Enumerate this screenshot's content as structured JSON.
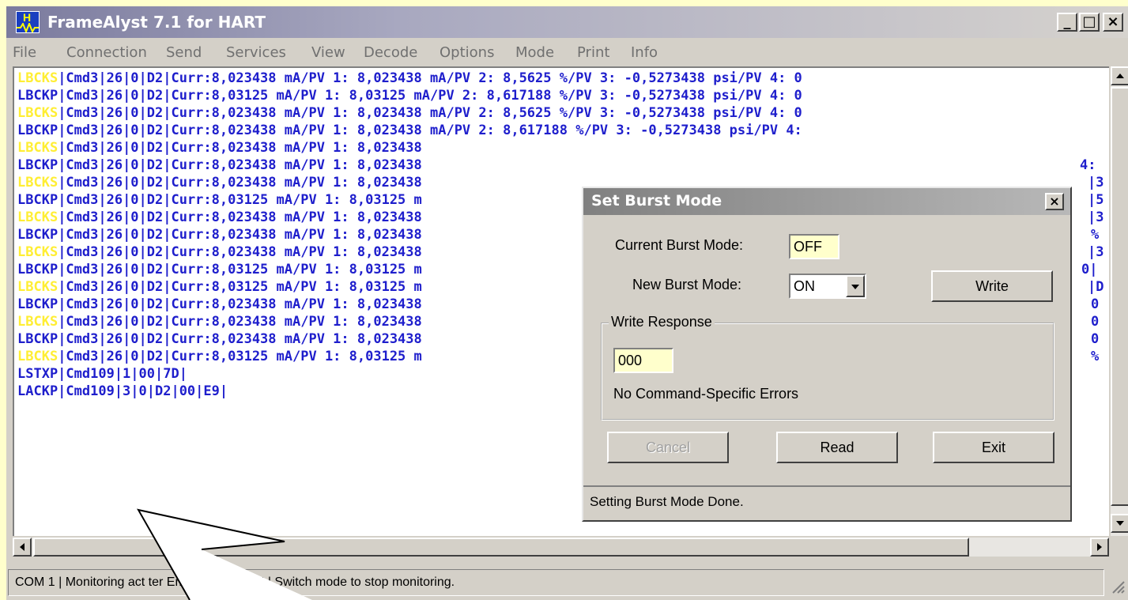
{
  "window": {
    "title": "FrameAlyst 7.1 for HART",
    "icon_letter": "H"
  },
  "menu": [
    "File",
    "Connection",
    "Send",
    "Services",
    "View",
    "Decode",
    "Options",
    "Mode",
    "Print",
    "Info"
  ],
  "log": {
    "lines": [
      {
        "src": "LBCKS",
        "text": "|Cmd3|26|0|D2|Curr:8,023438 mA/PV 1: 8,023438 mA/PV 2: 8,5625 %/PV 3: -0,5273438 psi/PV 4: 0"
      },
      {
        "src": "LBCKP",
        "text": "|Cmd3|26|0|D2|Curr:8,03125 mA/PV 1: 8,03125 mA/PV 2: 8,617188 %/PV 3: -0,5273438 psi/PV 4: 0"
      },
      {
        "src": "LBCKS",
        "text": "|Cmd3|26|0|D2|Curr:8,023438 mA/PV 1: 8,023438 mA/PV 2: 8,5625 %/PV 3: -0,5273438 psi/PV 4: 0"
      },
      {
        "src": "LBCKP",
        "text": "|Cmd3|26|0|D2|Curr:8,023438 mA/PV 1: 8,023438 mA/PV 2: 8,617188 %/PV 3: -0,5273438 psi/PV 4:"
      },
      {
        "src": "LBCKS",
        "text": "|Cmd3|26|0|D2|Curr:8,023438 mA/PV 1: 8,023438"
      },
      {
        "src": "LBCKP",
        "text": "|Cmd3|26|0|D2|Curr:8,023438 mA/PV 1: 8,023438"
      },
      {
        "src": "LBCKS",
        "text": "|Cmd3|26|0|D2|Curr:8,023438 mA/PV 1: 8,023438"
      },
      {
        "src": "LBCKP",
        "text": "|Cmd3|26|0|D2|Curr:8,03125 mA/PV 1: 8,03125 m"
      },
      {
        "src": "LBCKS",
        "text": "|Cmd3|26|0|D2|Curr:8,023438 mA/PV 1: 8,023438"
      },
      {
        "src": "LBCKP",
        "text": "|Cmd3|26|0|D2|Curr:8,023438 mA/PV 1: 8,023438"
      },
      {
        "src": "LBCKS",
        "text": "|Cmd3|26|0|D2|Curr:8,023438 mA/PV 1: 8,023438"
      },
      {
        "src": "LBCKP",
        "text": "|Cmd3|26|0|D2|Curr:8,03125 mA/PV 1: 8,03125 m"
      },
      {
        "src": "LBCKS",
        "text": "|Cmd3|26|0|D2|Curr:8,03125 mA/PV 1: 8,03125 m"
      },
      {
        "src": "LBCKP",
        "text": "|Cmd3|26|0|D2|Curr:8,023438 mA/PV 1: 8,023438"
      },
      {
        "src": "LBCKS",
        "text": "|Cmd3|26|0|D2|Curr:8,023438 mA/PV 1: 8,023438"
      },
      {
        "src": "LBCKP",
        "text": "|Cmd3|26|0|D2|Curr:8,023438 mA/PV 1: 8,023438"
      },
      {
        "src": "LBCKS",
        "text": "|Cmd3|26|0|D2|Curr:8,03125 mA/PV 1: 8,03125 m"
      },
      {
        "src": "",
        "text": "LSTXP|Cmd109|1|00|7D|"
      },
      {
        "src": "",
        "text": "LACKP|Cmd109|3|0|D2|00|E9|"
      }
    ],
    "right_fragments": [
      "4:",
      "|3",
      "|5",
      "|3",
      "%",
      "|3",
      "0|",
      "|D",
      "0",
      "0",
      "0",
      "%"
    ]
  },
  "status_bar": {
    "text": "COM 1 | Monitoring act       ter Emulator active!!! | Switch mode to stop monitoring."
  },
  "dialog": {
    "title": "Set Burst Mode",
    "current_label": "Current Burst Mode:",
    "current_value": "OFF",
    "new_label": "New Burst Mode:",
    "new_value": "ON",
    "write_button": "Write",
    "group_title": "Write Response",
    "response_code": "000",
    "response_text": "No Command-Specific Errors",
    "cancel_button": "Cancel",
    "read_button": "Read",
    "exit_button": "Exit",
    "status": "Setting Burst Mode Done."
  },
  "colors": {
    "page_background": "#ffffcc",
    "log_text": "#1e1ecc",
    "log_source_yellow": "#ffee33"
  }
}
